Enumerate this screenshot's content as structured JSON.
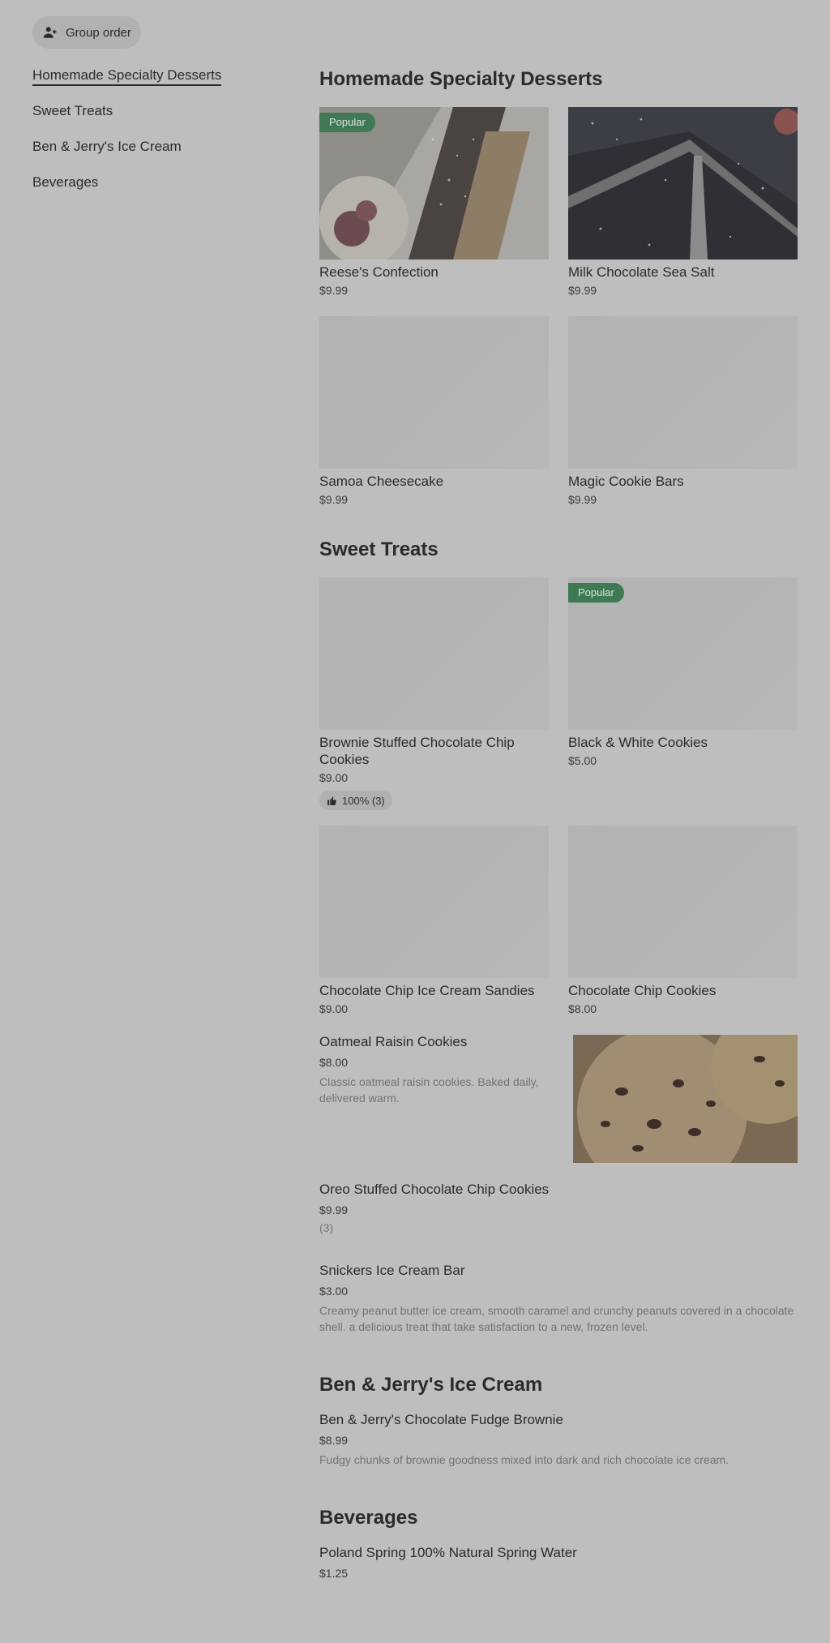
{
  "group_order": {
    "label": "Group order",
    "icon": "person-plus-icon"
  },
  "sidebar": {
    "items": [
      {
        "label": "Homemade Specialty Desserts",
        "active": true
      },
      {
        "label": "Sweet Treats"
      },
      {
        "label": "Ben & Jerry's Ice Cream"
      },
      {
        "label": "Beverages"
      }
    ]
  },
  "sections": {
    "desserts": {
      "title": "Homemade Specialty Desserts",
      "items": [
        {
          "name": "Reese's Confection",
          "price": "$9.99",
          "badge": "Popular"
        },
        {
          "name": "Milk Chocolate Sea Salt",
          "price": "$9.99"
        },
        {
          "name": "Samoa Cheesecake",
          "price": "$9.99"
        },
        {
          "name": "Magic Cookie Bars",
          "price": "$9.99"
        }
      ]
    },
    "sweet": {
      "title": "Sweet Treats",
      "cards": [
        {
          "name": "Brownie Stuffed Chocolate Chip Cookies",
          "price": "$9.00",
          "rating": "100% (3)"
        },
        {
          "name": "Black & White Cookies",
          "price": "$5.00",
          "badge": "Popular"
        },
        {
          "name": "Chocolate Chip Ice Cream Sandies",
          "price": "$9.00"
        },
        {
          "name": "Chocolate Chip Cookies",
          "price": "$8.00"
        }
      ],
      "list": [
        {
          "name": "Oatmeal Raisin Cookies",
          "price": "$8.00",
          "desc": "Classic oatmeal raisin cookies. Baked daily, delivered warm."
        },
        {
          "name": "Oreo Stuffed Chocolate Chip Cookies",
          "price": "$9.99",
          "count": "(3)"
        },
        {
          "name": "Snickers Ice Cream Bar",
          "price": "$3.00",
          "desc": "Creamy peanut butter ice cream, smooth caramel and crunchy peanuts covered in a chocolate shell. a delicious treat that take satisfaction to a new, frozen level."
        }
      ]
    },
    "benjerry": {
      "title": "Ben & Jerry's Ice Cream",
      "items": [
        {
          "name": "Ben & Jerry's Chocolate Fudge Brownie",
          "price": "$8.99",
          "desc": "Fudgy chunks of brownie goodness mixed into dark and rich chocolate ice cream."
        }
      ]
    },
    "beverages": {
      "title": "Beverages",
      "items": [
        {
          "name": "Poland Spring 100% Natural Spring Water",
          "price": "$1.25"
        }
      ]
    }
  },
  "colors": {
    "background": "#bebebe",
    "badge": "#3f7a55",
    "placeholder": "#b4b4b4"
  }
}
